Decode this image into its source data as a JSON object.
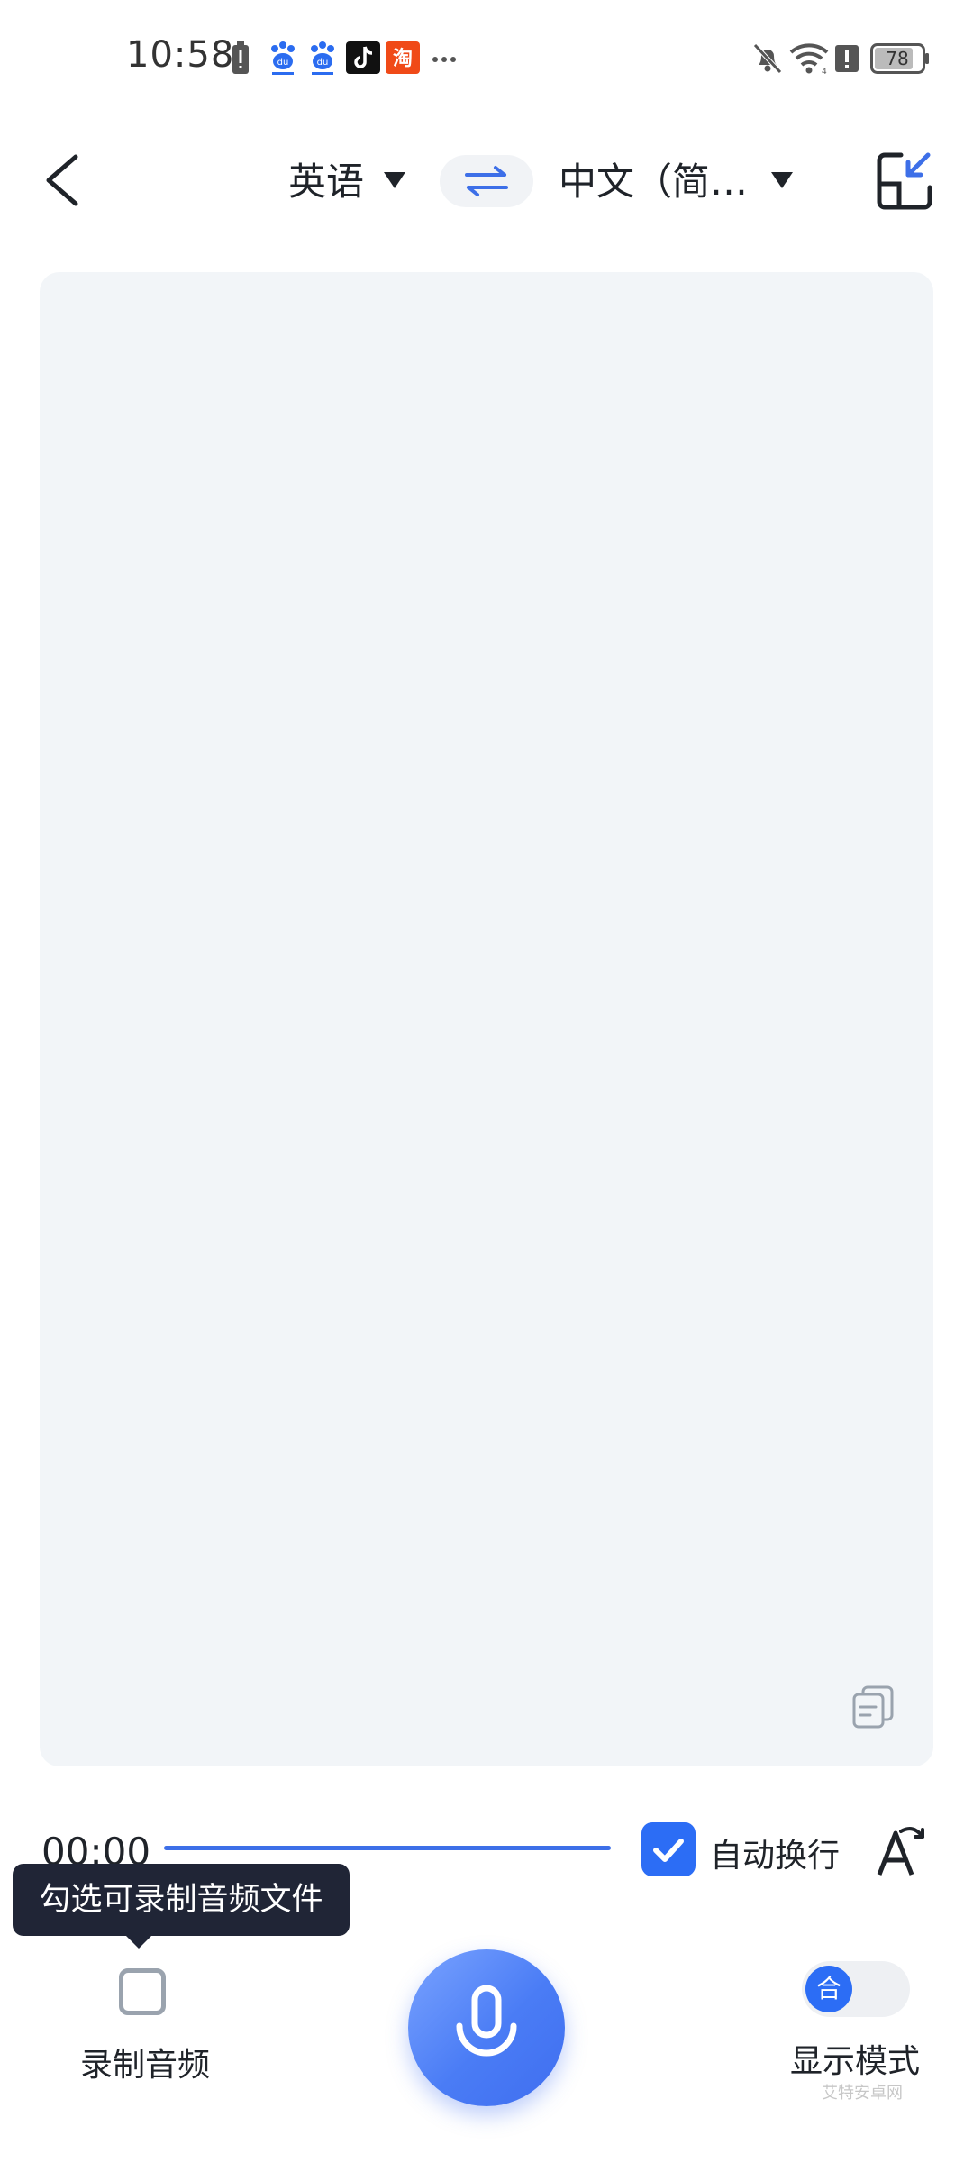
{
  "status_bar": {
    "time": "10:58",
    "notification_icons": [
      "battery-alert-icon",
      "baidu-icon",
      "baidu-icon",
      "tiktok-icon",
      "taobao-icon",
      "more-dots-icon"
    ],
    "right_icons": [
      "mute-bell-icon",
      "wifi-icon",
      "alert-icon",
      "battery-icon"
    ],
    "battery_level": "78"
  },
  "header": {
    "source_language": "英语",
    "target_language": "中文（简…",
    "accent_color": "#3d6fe8"
  },
  "controls": {
    "timer": "00:00",
    "auto_wrap_label": "自动换行",
    "auto_wrap_checked": true
  },
  "tooltip": {
    "text": "勾选可录制音频文件"
  },
  "bottom": {
    "record_audio_label": "录制音频",
    "record_audio_checked": false,
    "display_mode_label": "显示模式",
    "display_mode_knob": "合"
  },
  "watermark": "艾特安卓网"
}
